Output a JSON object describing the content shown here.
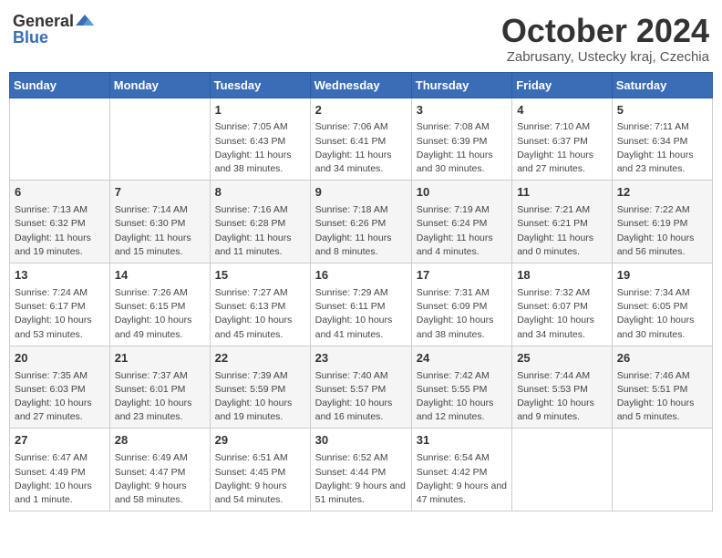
{
  "header": {
    "logo_general": "General",
    "logo_blue": "Blue",
    "title": "October 2024",
    "location": "Zabrusany, Ustecky kraj, Czechia"
  },
  "days_of_week": [
    "Sunday",
    "Monday",
    "Tuesday",
    "Wednesday",
    "Thursday",
    "Friday",
    "Saturday"
  ],
  "weeks": [
    [
      {
        "day": "",
        "detail": ""
      },
      {
        "day": "",
        "detail": ""
      },
      {
        "day": "1",
        "detail": "Sunrise: 7:05 AM\nSunset: 6:43 PM\nDaylight: 11 hours and 38 minutes."
      },
      {
        "day": "2",
        "detail": "Sunrise: 7:06 AM\nSunset: 6:41 PM\nDaylight: 11 hours and 34 minutes."
      },
      {
        "day": "3",
        "detail": "Sunrise: 7:08 AM\nSunset: 6:39 PM\nDaylight: 11 hours and 30 minutes."
      },
      {
        "day": "4",
        "detail": "Sunrise: 7:10 AM\nSunset: 6:37 PM\nDaylight: 11 hours and 27 minutes."
      },
      {
        "day": "5",
        "detail": "Sunrise: 7:11 AM\nSunset: 6:34 PM\nDaylight: 11 hours and 23 minutes."
      }
    ],
    [
      {
        "day": "6",
        "detail": "Sunrise: 7:13 AM\nSunset: 6:32 PM\nDaylight: 11 hours and 19 minutes."
      },
      {
        "day": "7",
        "detail": "Sunrise: 7:14 AM\nSunset: 6:30 PM\nDaylight: 11 hours and 15 minutes."
      },
      {
        "day": "8",
        "detail": "Sunrise: 7:16 AM\nSunset: 6:28 PM\nDaylight: 11 hours and 11 minutes."
      },
      {
        "day": "9",
        "detail": "Sunrise: 7:18 AM\nSunset: 6:26 PM\nDaylight: 11 hours and 8 minutes."
      },
      {
        "day": "10",
        "detail": "Sunrise: 7:19 AM\nSunset: 6:24 PM\nDaylight: 11 hours and 4 minutes."
      },
      {
        "day": "11",
        "detail": "Sunrise: 7:21 AM\nSunset: 6:21 PM\nDaylight: 11 hours and 0 minutes."
      },
      {
        "day": "12",
        "detail": "Sunrise: 7:22 AM\nSunset: 6:19 PM\nDaylight: 10 hours and 56 minutes."
      }
    ],
    [
      {
        "day": "13",
        "detail": "Sunrise: 7:24 AM\nSunset: 6:17 PM\nDaylight: 10 hours and 53 minutes."
      },
      {
        "day": "14",
        "detail": "Sunrise: 7:26 AM\nSunset: 6:15 PM\nDaylight: 10 hours and 49 minutes."
      },
      {
        "day": "15",
        "detail": "Sunrise: 7:27 AM\nSunset: 6:13 PM\nDaylight: 10 hours and 45 minutes."
      },
      {
        "day": "16",
        "detail": "Sunrise: 7:29 AM\nSunset: 6:11 PM\nDaylight: 10 hours and 41 minutes."
      },
      {
        "day": "17",
        "detail": "Sunrise: 7:31 AM\nSunset: 6:09 PM\nDaylight: 10 hours and 38 minutes."
      },
      {
        "day": "18",
        "detail": "Sunrise: 7:32 AM\nSunset: 6:07 PM\nDaylight: 10 hours and 34 minutes."
      },
      {
        "day": "19",
        "detail": "Sunrise: 7:34 AM\nSunset: 6:05 PM\nDaylight: 10 hours and 30 minutes."
      }
    ],
    [
      {
        "day": "20",
        "detail": "Sunrise: 7:35 AM\nSunset: 6:03 PM\nDaylight: 10 hours and 27 minutes."
      },
      {
        "day": "21",
        "detail": "Sunrise: 7:37 AM\nSunset: 6:01 PM\nDaylight: 10 hours and 23 minutes."
      },
      {
        "day": "22",
        "detail": "Sunrise: 7:39 AM\nSunset: 5:59 PM\nDaylight: 10 hours and 19 minutes."
      },
      {
        "day": "23",
        "detail": "Sunrise: 7:40 AM\nSunset: 5:57 PM\nDaylight: 10 hours and 16 minutes."
      },
      {
        "day": "24",
        "detail": "Sunrise: 7:42 AM\nSunset: 5:55 PM\nDaylight: 10 hours and 12 minutes."
      },
      {
        "day": "25",
        "detail": "Sunrise: 7:44 AM\nSunset: 5:53 PM\nDaylight: 10 hours and 9 minutes."
      },
      {
        "day": "26",
        "detail": "Sunrise: 7:46 AM\nSunset: 5:51 PM\nDaylight: 10 hours and 5 minutes."
      }
    ],
    [
      {
        "day": "27",
        "detail": "Sunrise: 6:47 AM\nSunset: 4:49 PM\nDaylight: 10 hours and 1 minute."
      },
      {
        "day": "28",
        "detail": "Sunrise: 6:49 AM\nSunset: 4:47 PM\nDaylight: 9 hours and 58 minutes."
      },
      {
        "day": "29",
        "detail": "Sunrise: 6:51 AM\nSunset: 4:45 PM\nDaylight: 9 hours and 54 minutes."
      },
      {
        "day": "30",
        "detail": "Sunrise: 6:52 AM\nSunset: 4:44 PM\nDaylight: 9 hours and 51 minutes."
      },
      {
        "day": "31",
        "detail": "Sunrise: 6:54 AM\nSunset: 4:42 PM\nDaylight: 9 hours and 47 minutes."
      },
      {
        "day": "",
        "detail": ""
      },
      {
        "day": "",
        "detail": ""
      }
    ]
  ]
}
